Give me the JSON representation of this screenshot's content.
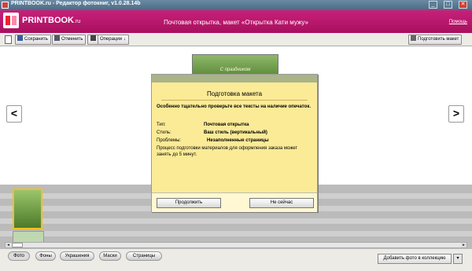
{
  "window": {
    "title": "PRINTBOOK.ru - Редактор фотокниг, v1.0.28.14b",
    "minimize": "_",
    "maximize": "□",
    "close": "✕"
  },
  "header": {
    "logo_name": "PRINTBOOK",
    "logo_suffix": ".ru",
    "title": "Почтовая открытка, макет «Открытка Кати мужу»",
    "help": "Помощь"
  },
  "toolbar": {
    "save": "Сохранить",
    "undo": "Отменить",
    "operations": "Операции ↓",
    "prepare": "Подготовить макет"
  },
  "stage": {
    "postcard_text": "С праздником",
    "prev_arrow": "<",
    "next_arrow": ">"
  },
  "dialog": {
    "title": "Подготовка макета",
    "warning": "Особенно тщательно проверьте все тексты на наличие опечаток.",
    "rows": [
      {
        "label": "Тип:",
        "value": "Почтовая открытка"
      },
      {
        "label": "Стиль:",
        "value": "Ваш стиль (вертикальный)"
      },
      {
        "label": "Проблемы:",
        "value": "Незаполненные страницы"
      }
    ],
    "note": "Процесс подготовки материалов для оформления заказа может занять до 5 минут.",
    "continue_button": "Продолжить",
    "cancel_button": "Не сейчас"
  },
  "bottom_tabs": [
    "Фото",
    "Фоны",
    "Украшения",
    "Маски",
    "Страницы"
  ],
  "active_tab": 0,
  "add_photo": "Добавить фото в коллекцию",
  "add_photo_arrow": "▾",
  "colors": {
    "header": "#b81268",
    "dialog_bg": "#fbeb97",
    "dialog_header": "#a9b488",
    "strip": "#bbbbbb"
  }
}
